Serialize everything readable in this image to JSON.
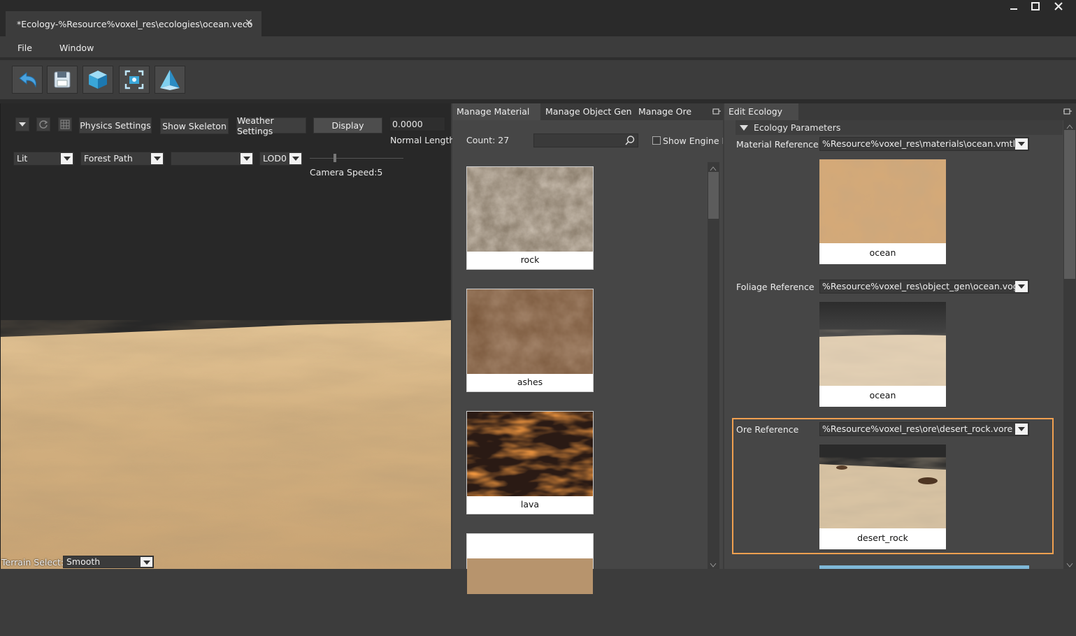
{
  "window": {
    "doc_tab_title": "*Ecology-%Resource%voxel_res\\ecologies\\ocean.veco",
    "close_glyph": "✕",
    "minimize_glyph": "▁",
    "maximize_glyph": "☐",
    "close_window_glyph": "✕"
  },
  "menu": {
    "file": "File",
    "window": "Window"
  },
  "toolbar": {
    "icons": [
      "undo-icon",
      "save-icon",
      "cube-icon",
      "camera-frame-icon",
      "pyramid-icon"
    ]
  },
  "viewport": {
    "physics_settings": "Physics Settings",
    "show_skeleton": "Show Skeleton",
    "weather_settings": "Weather Settings",
    "display": "Display",
    "normal_length_value": "0.0000",
    "normal_length_label": "Normal Length",
    "lighting_mode": "Lit",
    "scene": "Forest Path",
    "empty_combo": "",
    "lod": "LOD0",
    "camera_speed": "Camera Speed:5",
    "terrain_select_label": "Terrain Select:",
    "terrain_select_value": "Smooth"
  },
  "mid_panel": {
    "tabs": [
      "Manage Material",
      "Manage Object Gen",
      "Manage Ore"
    ],
    "count": "Count: 27",
    "search_value": "",
    "show_engine": "Show Engine R",
    "materials": [
      {
        "name": "rock"
      },
      {
        "name": "ashes"
      },
      {
        "name": "lava"
      },
      {
        "name": ""
      }
    ]
  },
  "right_panel": {
    "tab": "Edit Ecology",
    "section": "Ecology Parameters",
    "material_ref_label": "Material Reference",
    "material_ref_value": "%Resource%voxel_res\\materials\\ocean.vmtl",
    "material_preview": "ocean",
    "foliage_ref_label": "Foliage Reference",
    "foliage_ref_value": "%Resource%voxel_res\\object_gen\\ocean.vog",
    "foliage_preview": "ocean",
    "ore_ref_label": "Ore Reference",
    "ore_ref_value": "%Resource%voxel_res\\ore\\desert_rock.vore",
    "ore_preview": "desert_rock"
  },
  "colors": {
    "highlight": "#f0a050",
    "sand": "#d9b98a",
    "dark_bg": "#282828",
    "panel_bg": "#464646"
  }
}
